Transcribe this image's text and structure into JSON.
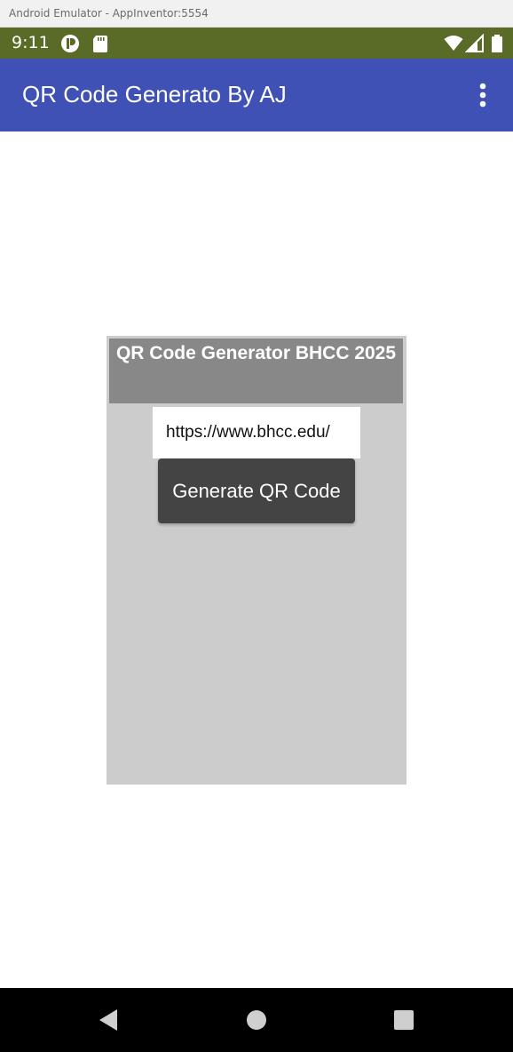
{
  "window": {
    "title": "Android Emulator - AppInventor:5554"
  },
  "status_bar": {
    "time": "9:11",
    "icons": [
      "notification-app-icon",
      "sd-card-icon",
      "wifi-icon",
      "signal-icon",
      "battery-icon"
    ]
  },
  "app_bar": {
    "title": "QR Code Generato By AJ",
    "menu_icon": "overflow-menu-icon",
    "color": "#3f51b5"
  },
  "panel": {
    "header": "QR Code Generator BHCC 2025",
    "url_input_value": "https://www.bhcc.edu/",
    "generate_button_label": "Generate QR Code"
  },
  "nav_bar": {
    "icons": [
      "back-icon",
      "home-icon",
      "recents-icon"
    ]
  },
  "colors": {
    "status_bar": "#5a6b28",
    "panel_bg": "#cccccc",
    "header_bg": "#888888",
    "button_bg": "#444444"
  }
}
